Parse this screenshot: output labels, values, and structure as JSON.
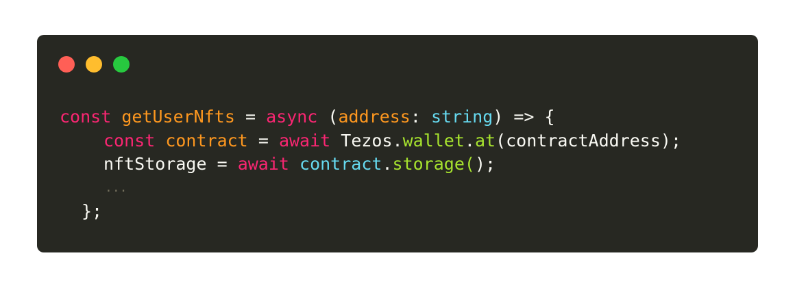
{
  "window": {
    "buttons": [
      {
        "name": "close",
        "color": "#ff5f56"
      },
      {
        "name": "minimize",
        "color": "#ffbd2e"
      },
      {
        "name": "zoom",
        "color": "#27c93f"
      }
    ]
  },
  "theme": {
    "background": "#272822",
    "text": "#f8f8f2",
    "keyword": "#f92672",
    "identifier": "#fd971f",
    "type": "#66d9ef",
    "function": "#a6e22e",
    "comment": "#75715e"
  },
  "code": {
    "line1": {
      "kw_const": "const",
      "fn_name": "getUserNfts",
      "op_eq": "=",
      "kw_async": "async",
      "paren_open": "(",
      "param": "address",
      "colon": ":",
      "type": "string",
      "rest": ") => {"
    },
    "line2": {
      "kw_const": "const",
      "var": "contract",
      "op_eq": "=",
      "kw_await": "await",
      "obj": "Tezos",
      "dot1": ".",
      "prop": "wallet",
      "dot2": ".",
      "method": "at",
      "args": "(contractAddress);"
    },
    "line3": {
      "var": "nftStorage",
      "op_eq": "=",
      "kw_await": "await",
      "obj": "contract",
      "dot": ".",
      "method": "storage",
      "paren_open": "(",
      "paren_close": ");"
    },
    "line4": {
      "ellipsis": "..."
    },
    "line5": {
      "close": "};"
    }
  }
}
